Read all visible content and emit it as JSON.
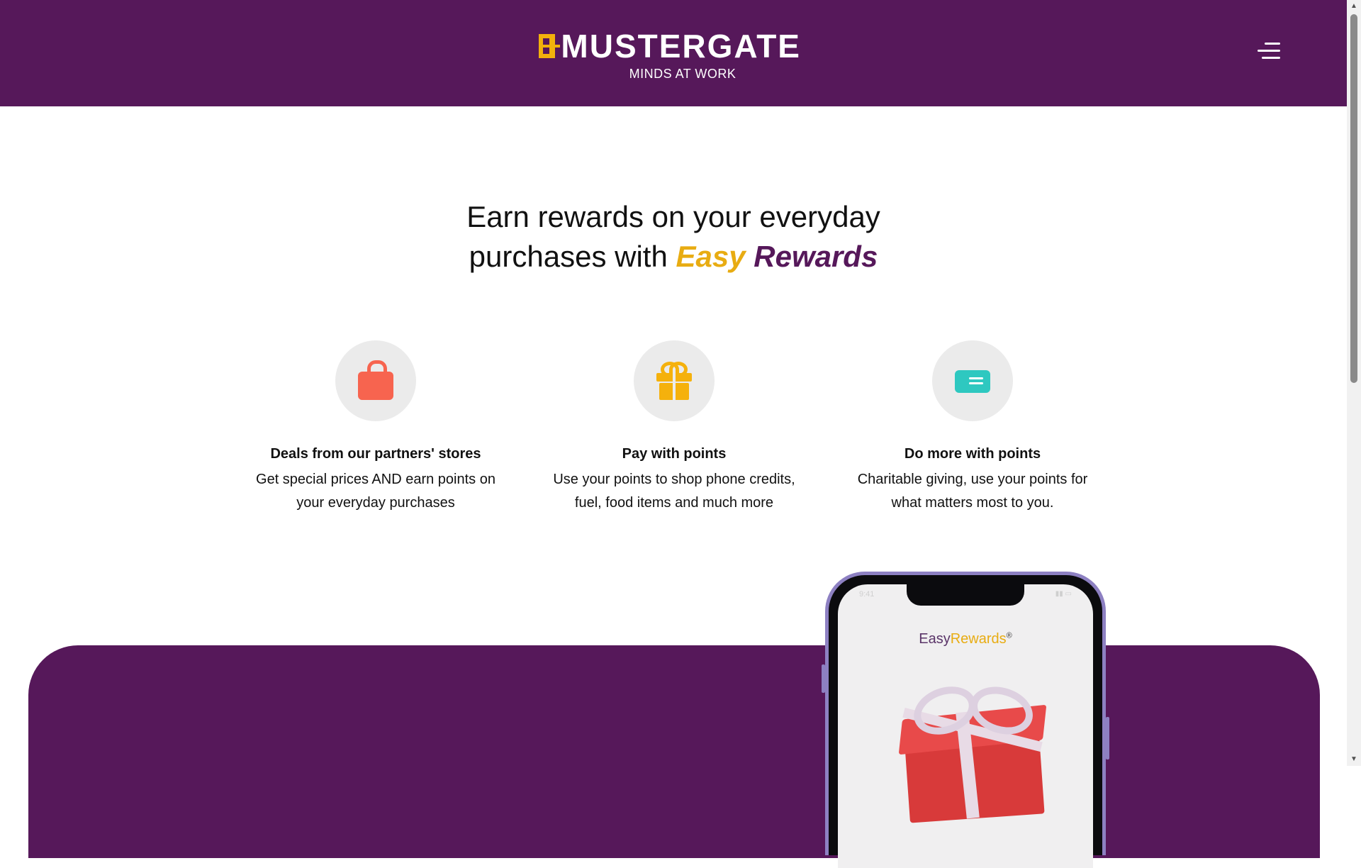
{
  "header": {
    "brand_name": "MUSTERGATE",
    "tagline": "MINDS AT WORK",
    "logo_icon": "window-logo-icon",
    "menu_icon": "hamburger-menu-icon"
  },
  "hero": {
    "title_line1": "Earn rewards on your everyday",
    "title_line2_prefix": "purchases with",
    "brand_easy": "Easy",
    "brand_rewards": "Rewards"
  },
  "features": [
    {
      "icon": "shopping-bag-icon",
      "title": "Deals from our partners' stores",
      "desc_line1": "Get special prices AND earn points on",
      "desc_line2": "your everyday purchases"
    },
    {
      "icon": "gift-icon",
      "title": "Pay with points",
      "desc_line1": "Use your points to shop phone credits,",
      "desc_line2": "fuel, food items and much more"
    },
    {
      "icon": "card-icon",
      "title": "Do more with points",
      "desc_line1": "Charitable giving, use your points for",
      "desc_line2": "what matters most to you."
    }
  ],
  "phone": {
    "time": "9:41",
    "app_logo_part1": "Easy",
    "app_logo_part2": "Rewards",
    "app_logo_mark": "®"
  },
  "scrollbar": {
    "up": "▲",
    "down": "▼"
  },
  "colors": {
    "brand_purple": "#56185a",
    "brand_gold": "#e8ac12",
    "bag_coral": "#f7644f",
    "gift_yellow": "#f5b10c",
    "card_teal": "#2ec8c0"
  }
}
